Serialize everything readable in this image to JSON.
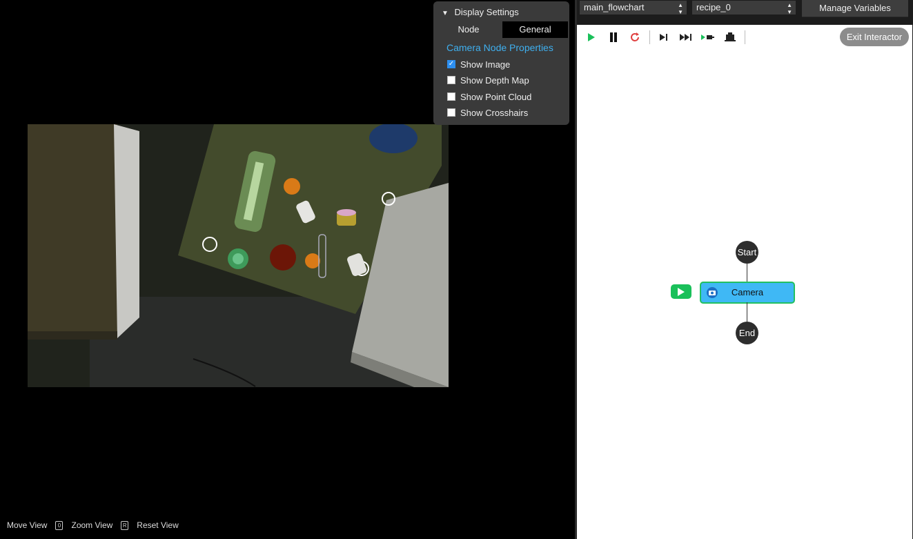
{
  "display_settings": {
    "title": "Display Settings",
    "tabs": [
      "Node",
      "General"
    ],
    "active_tab": "General",
    "section_title": "Camera Node Properties",
    "options": [
      {
        "label": "Show Image",
        "checked": true
      },
      {
        "label": "Show Depth Map",
        "checked": false
      },
      {
        "label": "Show Point Cloud",
        "checked": false
      },
      {
        "label": "Show Crosshairs",
        "checked": false
      }
    ]
  },
  "view_controls": {
    "move": "Move View",
    "zoom": "Zoom View",
    "zoom_key": "0",
    "reset": "Reset View",
    "reset_key": "R"
  },
  "flowchart": {
    "flow_select": "main_flowchart",
    "recipe_select": "recipe_0",
    "manage_variables": "Manage Variables",
    "exit_interactor": "Exit Interactor",
    "nodes": {
      "start": "Start",
      "camera": "Camera",
      "end": "End"
    }
  },
  "colors": {
    "accent_blue": "#3fb0f0",
    "run_green": "#1ac05a",
    "camera_node": "#3fb8f5"
  }
}
